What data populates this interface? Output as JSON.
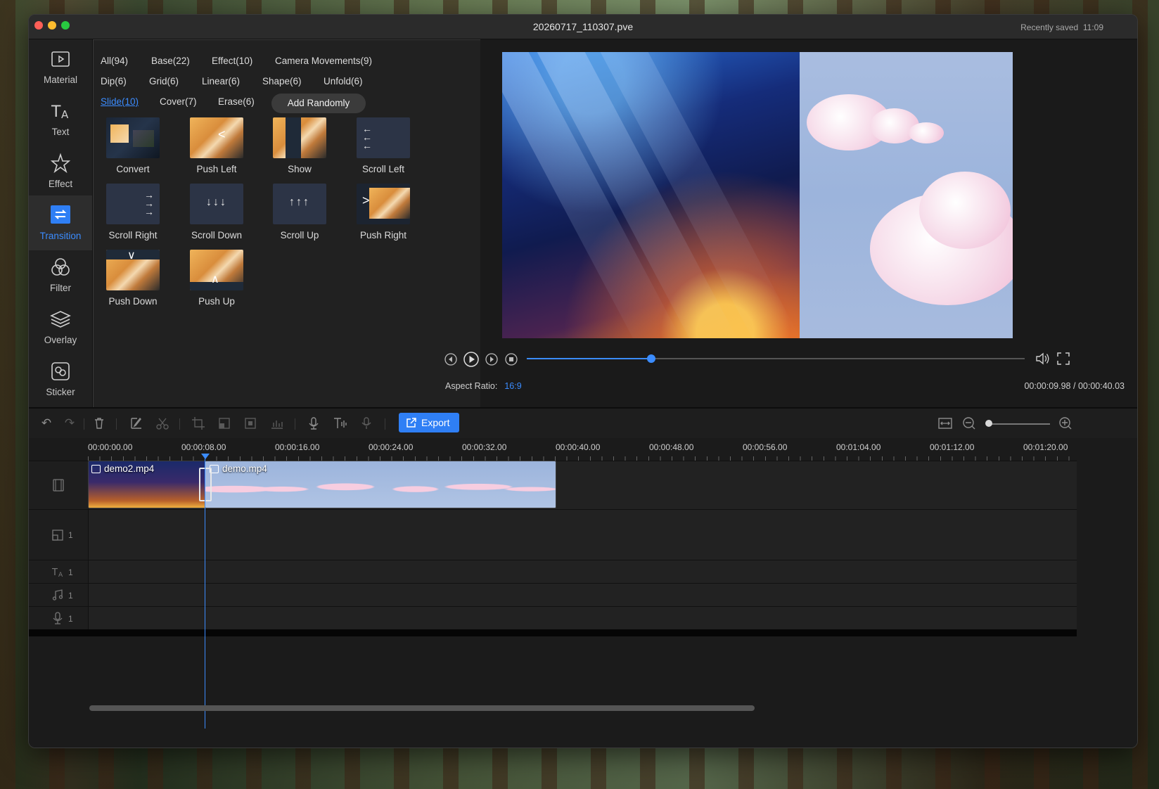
{
  "window": {
    "title": "20260717_110307.pve",
    "saved_label": "Recently saved",
    "saved_time": "11:09",
    "traffic_lights": [
      "#ff5f57",
      "#febc2e",
      "#28c840"
    ]
  },
  "sidebar": {
    "items": [
      {
        "label": "Material",
        "icon": "play-folder-icon"
      },
      {
        "label": "Text",
        "icon": "text-icon"
      },
      {
        "label": "Effect",
        "icon": "star-icon"
      },
      {
        "label": "Transition",
        "icon": "transition-icon",
        "active": true
      },
      {
        "label": "Filter",
        "icon": "filter-icon"
      },
      {
        "label": "Overlay",
        "icon": "layers-icon"
      },
      {
        "label": "Sticker",
        "icon": "sticker-icon"
      }
    ]
  },
  "categories": {
    "row1": [
      "All(94)",
      "Base(22)",
      "Effect(10)",
      "Camera Movements(9)"
    ],
    "row2": [
      "Dip(6)",
      "Grid(6)",
      "Linear(6)",
      "Shape(6)",
      "Unfold(6)"
    ],
    "row3": [
      "Slide(10)",
      "Cover(7)",
      "Erase(6)"
    ],
    "add_randomly": "Add Randomly",
    "active": "Slide(10)"
  },
  "transitions": [
    {
      "label": "Convert",
      "glyph": ""
    },
    {
      "label": "Push Left",
      "glyph": "<"
    },
    {
      "label": "Show",
      "glyph": ""
    },
    {
      "label": "Scroll Left",
      "glyph": "←\n←\n←"
    },
    {
      "label": "Scroll Right",
      "glyph": "→\n→\n→"
    },
    {
      "label": "Scroll Down",
      "glyph": "↓↓↓"
    },
    {
      "label": "Scroll Up",
      "glyph": "↑↑↑"
    },
    {
      "label": "Push Right",
      "glyph": ">"
    },
    {
      "label": "Push Down",
      "glyph": "∨"
    },
    {
      "label": "Push Up",
      "glyph": "∧"
    }
  ],
  "player": {
    "aspect_label": "Aspect Ratio:",
    "aspect_value": "16:9",
    "current_time": "00:00:09.98",
    "separator": "/",
    "total_time": "00:00:40.03",
    "progress": 0.25
  },
  "toolbar": {
    "export_label": "Export",
    "zoom_level": 0.0
  },
  "timeline": {
    "ruler": [
      "00:00:00.00",
      "00:00:08.00",
      "00:00:16.00",
      "00:00:24.00",
      "00:00:32.00",
      "00:00:40.00",
      "00:00:48.00",
      "00:00:56.00",
      "00:01:04.00",
      "00:01:12.00",
      "00:01:20.00"
    ],
    "clips": [
      {
        "name": "demo2.mp4"
      },
      {
        "name": "demo.mp4"
      }
    ],
    "tracks": [
      {
        "icon": "film-icon",
        "count": ""
      },
      {
        "icon": "overlay-track-icon",
        "count": "1"
      },
      {
        "icon": "text-track-icon",
        "count": "1"
      },
      {
        "icon": "music-icon",
        "count": "1"
      },
      {
        "icon": "mic-icon",
        "count": "1"
      }
    ]
  }
}
